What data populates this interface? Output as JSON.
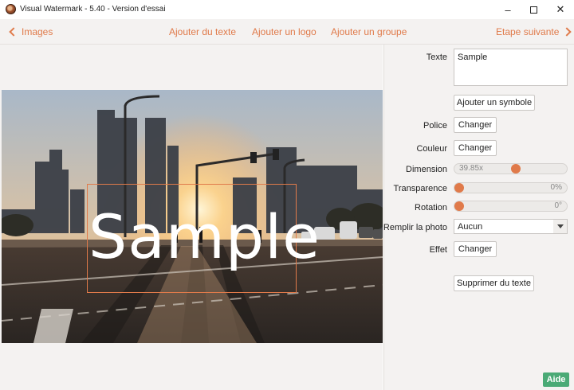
{
  "window": {
    "title": "Visual Watermark - 5.40 - Version d'essai"
  },
  "toolbar": {
    "images_label": "Images",
    "add_text_label": "Ajouter du texte",
    "add_logo_label": "Ajouter un logo",
    "add_group_label": "Ajouter un groupe",
    "next_step_label": "Etape suivante"
  },
  "watermark": {
    "text": "Sample"
  },
  "panel": {
    "texte_label": "Texte",
    "texte_value": "Sample",
    "add_symbol_label": "Ajouter un symbole",
    "police_label": "Police",
    "police_button": "Changer",
    "couleur_label": "Couleur",
    "couleur_button": "Changer",
    "dimension_label": "Dimension",
    "dimension_value": "39.85x",
    "dimension_level": 0.55,
    "transparence_label": "Transparence",
    "transparence_value": "0%",
    "transparence_level": 0.0,
    "rotation_label": "Rotation",
    "rotation_value": "0°",
    "rotation_level": 0.0,
    "remplir_label": "Remplir la photo",
    "remplir_value": "Aucun",
    "effet_label": "Effet",
    "effet_button": "Changer",
    "delete_text_label": "Supprimer du texte",
    "help_label": "Aide"
  },
  "colors": {
    "accent": "#e07a4a",
    "help": "#4aaa76"
  }
}
